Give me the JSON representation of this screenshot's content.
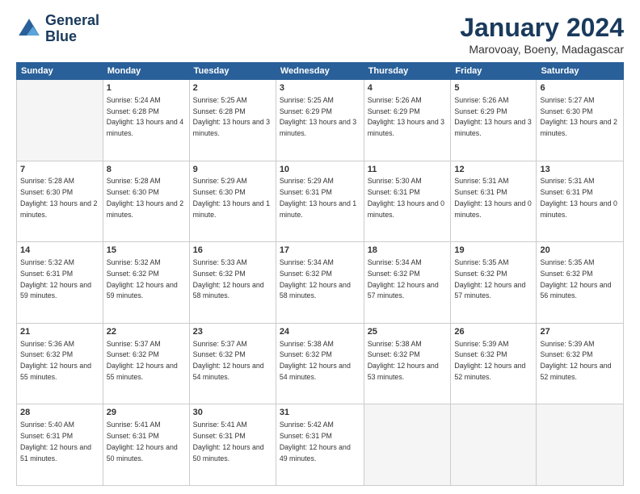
{
  "header": {
    "logo_line1": "General",
    "logo_line2": "Blue",
    "month_title": "January 2024",
    "location": "Marovoay, Boeny, Madagascar"
  },
  "columns": [
    "Sunday",
    "Monday",
    "Tuesday",
    "Wednesday",
    "Thursday",
    "Friday",
    "Saturday"
  ],
  "weeks": [
    [
      {
        "day": "",
        "sunrise": "",
        "sunset": "",
        "daylight": ""
      },
      {
        "day": "1",
        "sunrise": "5:24 AM",
        "sunset": "6:28 PM",
        "daylight": "13 hours and 4 minutes."
      },
      {
        "day": "2",
        "sunrise": "5:25 AM",
        "sunset": "6:28 PM",
        "daylight": "13 hours and 3 minutes."
      },
      {
        "day": "3",
        "sunrise": "5:25 AM",
        "sunset": "6:29 PM",
        "daylight": "13 hours and 3 minutes."
      },
      {
        "day": "4",
        "sunrise": "5:26 AM",
        "sunset": "6:29 PM",
        "daylight": "13 hours and 3 minutes."
      },
      {
        "day": "5",
        "sunrise": "5:26 AM",
        "sunset": "6:29 PM",
        "daylight": "13 hours and 3 minutes."
      },
      {
        "day": "6",
        "sunrise": "5:27 AM",
        "sunset": "6:30 PM",
        "daylight": "13 hours and 2 minutes."
      }
    ],
    [
      {
        "day": "7",
        "sunrise": "5:28 AM",
        "sunset": "6:30 PM",
        "daylight": "13 hours and 2 minutes."
      },
      {
        "day": "8",
        "sunrise": "5:28 AM",
        "sunset": "6:30 PM",
        "daylight": "13 hours and 2 minutes."
      },
      {
        "day": "9",
        "sunrise": "5:29 AM",
        "sunset": "6:30 PM",
        "daylight": "13 hours and 1 minute."
      },
      {
        "day": "10",
        "sunrise": "5:29 AM",
        "sunset": "6:31 PM",
        "daylight": "13 hours and 1 minute."
      },
      {
        "day": "11",
        "sunrise": "5:30 AM",
        "sunset": "6:31 PM",
        "daylight": "13 hours and 0 minutes."
      },
      {
        "day": "12",
        "sunrise": "5:31 AM",
        "sunset": "6:31 PM",
        "daylight": "13 hours and 0 minutes."
      },
      {
        "day": "13",
        "sunrise": "5:31 AM",
        "sunset": "6:31 PM",
        "daylight": "13 hours and 0 minutes."
      }
    ],
    [
      {
        "day": "14",
        "sunrise": "5:32 AM",
        "sunset": "6:31 PM",
        "daylight": "12 hours and 59 minutes."
      },
      {
        "day": "15",
        "sunrise": "5:32 AM",
        "sunset": "6:32 PM",
        "daylight": "12 hours and 59 minutes."
      },
      {
        "day": "16",
        "sunrise": "5:33 AM",
        "sunset": "6:32 PM",
        "daylight": "12 hours and 58 minutes."
      },
      {
        "day": "17",
        "sunrise": "5:34 AM",
        "sunset": "6:32 PM",
        "daylight": "12 hours and 58 minutes."
      },
      {
        "day": "18",
        "sunrise": "5:34 AM",
        "sunset": "6:32 PM",
        "daylight": "12 hours and 57 minutes."
      },
      {
        "day": "19",
        "sunrise": "5:35 AM",
        "sunset": "6:32 PM",
        "daylight": "12 hours and 57 minutes."
      },
      {
        "day": "20",
        "sunrise": "5:35 AM",
        "sunset": "6:32 PM",
        "daylight": "12 hours and 56 minutes."
      }
    ],
    [
      {
        "day": "21",
        "sunrise": "5:36 AM",
        "sunset": "6:32 PM",
        "daylight": "12 hours and 55 minutes."
      },
      {
        "day": "22",
        "sunrise": "5:37 AM",
        "sunset": "6:32 PM",
        "daylight": "12 hours and 55 minutes."
      },
      {
        "day": "23",
        "sunrise": "5:37 AM",
        "sunset": "6:32 PM",
        "daylight": "12 hours and 54 minutes."
      },
      {
        "day": "24",
        "sunrise": "5:38 AM",
        "sunset": "6:32 PM",
        "daylight": "12 hours and 54 minutes."
      },
      {
        "day": "25",
        "sunrise": "5:38 AM",
        "sunset": "6:32 PM",
        "daylight": "12 hours and 53 minutes."
      },
      {
        "day": "26",
        "sunrise": "5:39 AM",
        "sunset": "6:32 PM",
        "daylight": "12 hours and 52 minutes."
      },
      {
        "day": "27",
        "sunrise": "5:39 AM",
        "sunset": "6:32 PM",
        "daylight": "12 hours and 52 minutes."
      }
    ],
    [
      {
        "day": "28",
        "sunrise": "5:40 AM",
        "sunset": "6:31 PM",
        "daylight": "12 hours and 51 minutes."
      },
      {
        "day": "29",
        "sunrise": "5:41 AM",
        "sunset": "6:31 PM",
        "daylight": "12 hours and 50 minutes."
      },
      {
        "day": "30",
        "sunrise": "5:41 AM",
        "sunset": "6:31 PM",
        "daylight": "12 hours and 50 minutes."
      },
      {
        "day": "31",
        "sunrise": "5:42 AM",
        "sunset": "6:31 PM",
        "daylight": "12 hours and 49 minutes."
      },
      {
        "day": "",
        "sunrise": "",
        "sunset": "",
        "daylight": ""
      },
      {
        "day": "",
        "sunrise": "",
        "sunset": "",
        "daylight": ""
      },
      {
        "day": "",
        "sunrise": "",
        "sunset": "",
        "daylight": ""
      }
    ]
  ],
  "labels": {
    "sunrise": "Sunrise:",
    "sunset": "Sunset:",
    "daylight": "Daylight:"
  }
}
